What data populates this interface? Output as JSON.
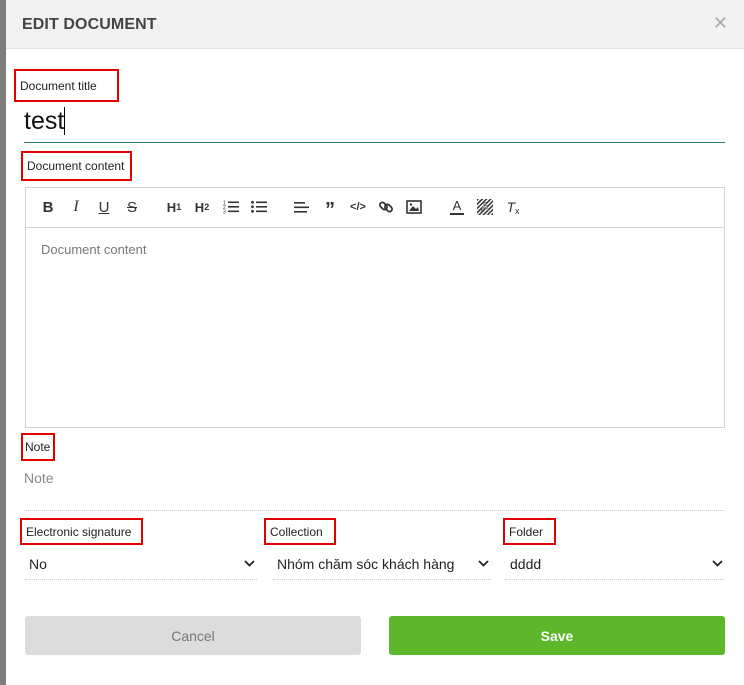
{
  "modal": {
    "title": "EDIT DOCUMENT",
    "close_icon": "close-icon"
  },
  "fields": {
    "title_label": "Document title",
    "title_value": "test",
    "content_label": "Document content",
    "content_placeholder": "Document content",
    "note_label": "Note",
    "note_placeholder": "Note",
    "signature_label": "Electronic signature",
    "signature_value": "No",
    "collection_label": "Collection",
    "collection_value": "Nhóm chăm sóc khách hàng",
    "folder_label": "Folder",
    "folder_value": "dddd"
  },
  "toolbar": {
    "buttons": [
      "bold-icon",
      "italic-icon",
      "underline-icon",
      "strikethrough-icon",
      "heading1-icon",
      "heading2-icon",
      "ordered-list-icon",
      "bullet-list-icon",
      "align-left-icon",
      "blockquote-icon",
      "code-icon",
      "link-icon",
      "image-icon",
      "text-color-icon",
      "highlight-icon",
      "clear-format-icon"
    ]
  },
  "actions": {
    "cancel_label": "Cancel",
    "save_label": "Save"
  },
  "colors": {
    "save": "#5cb82a",
    "cancel": "#dcdcdc",
    "highlight_border": "#e00000",
    "input_focus_line": "#2a7d74"
  }
}
